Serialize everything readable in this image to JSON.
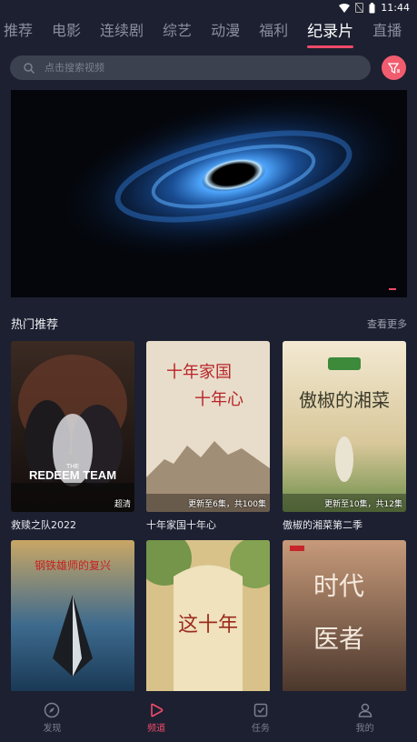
{
  "status_bar": {
    "time": "11:44"
  },
  "tabs": [
    {
      "label": "推荐"
    },
    {
      "label": "电影"
    },
    {
      "label": "连续剧"
    },
    {
      "label": "综艺"
    },
    {
      "label": "动漫"
    },
    {
      "label": "福利"
    },
    {
      "label": "纪录片"
    },
    {
      "label": "直播"
    }
  ],
  "active_tab_index": 6,
  "search": {
    "placeholder": "点击搜索视频"
  },
  "section": {
    "title": "热门推荐",
    "more": "查看更多"
  },
  "cards": [
    {
      "title": "救赎之队2022",
      "badge": "超清",
      "poster_text": "THE REDEEM TEAM"
    },
    {
      "title": "十年家国十年心",
      "badge": "更新至6集，共100集",
      "poster_text": "十年家国 十年心"
    },
    {
      "title": "傲椒的湘菜第二季",
      "badge": "更新至10集，共12集",
      "poster_text": "傲椒的湘菜"
    },
    {
      "title": "",
      "badge": "",
      "poster_text": "钢铁雄师的复兴"
    },
    {
      "title": "",
      "badge": "",
      "poster_text": "这十年"
    },
    {
      "title": "",
      "badge": "",
      "poster_text": "时代医者"
    }
  ],
  "bottom_nav": [
    {
      "label": "发现",
      "icon": "compass-icon"
    },
    {
      "label": "频道",
      "icon": "play-icon"
    },
    {
      "label": "任务",
      "icon": "task-icon"
    },
    {
      "label": "我的",
      "icon": "user-icon"
    }
  ],
  "colors": {
    "accent": "#f04a6a",
    "background": "#1c2030"
  }
}
